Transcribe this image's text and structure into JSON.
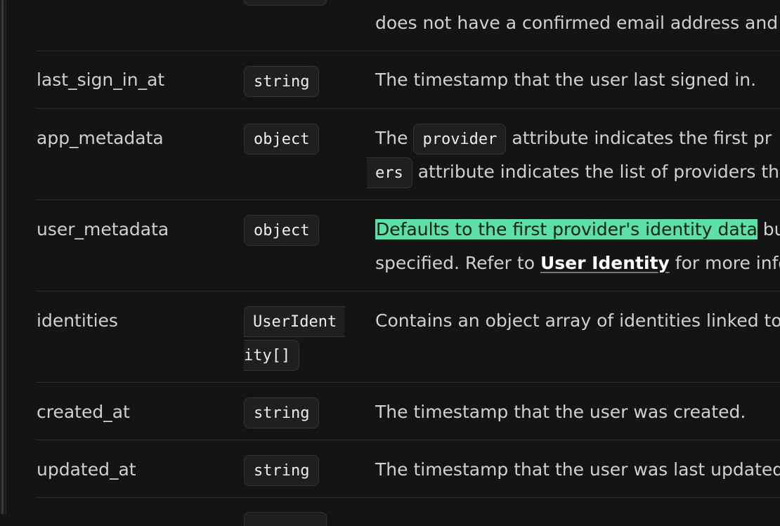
{
  "rows": [
    {
      "name": "",
      "type": "",
      "desc_line2": "does not have a confirmed email address and p"
    },
    {
      "name": "last_sign_in_at",
      "type": "string",
      "desc": "The timestamp that the user last signed in."
    },
    {
      "name": "app_metadata",
      "type": "object",
      "desc_prefix": "The ",
      "desc_code1": "provider",
      "desc_mid": " attribute indicates the first pr",
      "desc_code2": "ers",
      "desc_tail": " attribute indicates the list of providers th"
    },
    {
      "name": "user_metadata",
      "type": "object",
      "desc_highlight": "Defaults to the first provider's identity data",
      "desc_after_highlight": " bu",
      "desc_line2_prefix": "specified. Refer to ",
      "desc_link": "User Identity",
      "desc_line2_suffix": " for more infor"
    },
    {
      "name": "identities",
      "type_part1": "UserIdent",
      "type_part2": "ity[]",
      "desc": "Contains an object array of identities linked to"
    },
    {
      "name": "created_at",
      "type": "string",
      "desc": "The timestamp that the user was created."
    },
    {
      "name": "updated_at",
      "type": "string",
      "desc": "The timestamp that the user was last updated"
    }
  ],
  "colors": {
    "background": "#141414",
    "highlight": "#5ddfa8",
    "pill_bg": "#1f1f1f"
  }
}
